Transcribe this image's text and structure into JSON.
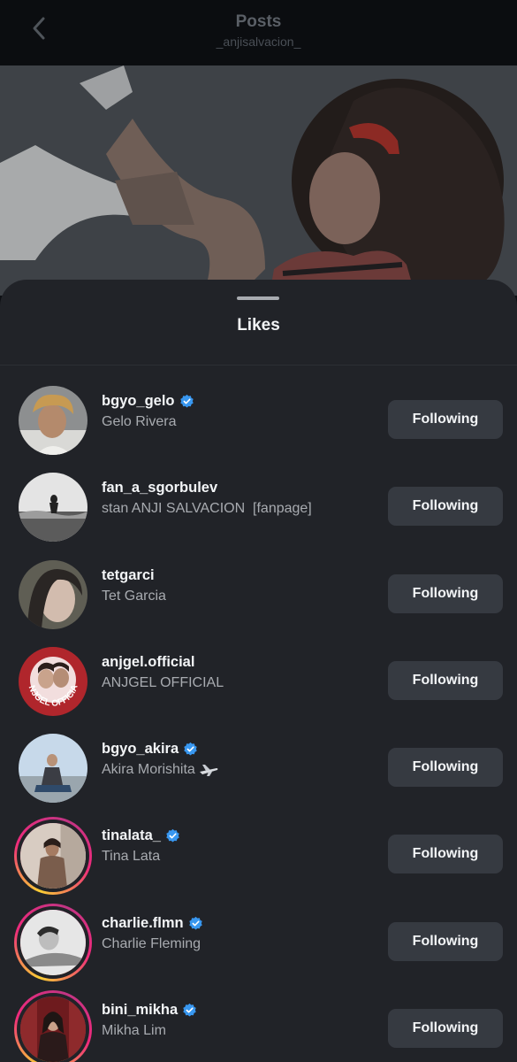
{
  "header": {
    "title": "Posts",
    "subtitle": "_anjisalvacion_"
  },
  "sheet": {
    "title": "Likes"
  },
  "likes": [
    {
      "username": "bgyo_gelo",
      "full_name": "Gelo Rivera",
      "verified": true,
      "story_ring": false,
      "button": "Following"
    },
    {
      "username": "fan_a_sgorbulev",
      "full_name": "stan ANJI SALVACION  [fanpage]",
      "verified": false,
      "story_ring": false,
      "button": "Following"
    },
    {
      "username": "tetgarci",
      "full_name": "Tet Garcia",
      "verified": false,
      "story_ring": false,
      "button": "Following"
    },
    {
      "username": "anjgel.official",
      "full_name": "ANJGEL OFFICIAL",
      "verified": false,
      "story_ring": false,
      "button": "Following"
    },
    {
      "username": "bgyo_akira",
      "full_name": "Akira Morishita",
      "verified": true,
      "story_ring": false,
      "button": "Following",
      "name_icon": "airplane-icon"
    },
    {
      "username": "tinalata_",
      "full_name": "Tina Lata",
      "verified": true,
      "story_ring": true,
      "button": "Following"
    },
    {
      "username": "charlie.flmn",
      "full_name": "Charlie Fleming",
      "verified": true,
      "story_ring": true,
      "button": "Following"
    },
    {
      "username": "bini_mikha",
      "full_name": "Mikha Lim",
      "verified": true,
      "story_ring": true,
      "button": "Following"
    }
  ],
  "avatar_badge_text": "ANJGEL OFFICIAL",
  "colors": {
    "sheet_bg": "#212328",
    "button_bg": "#363a41",
    "verified": "#3897f0",
    "secondary_text": "#a8abb0"
  }
}
